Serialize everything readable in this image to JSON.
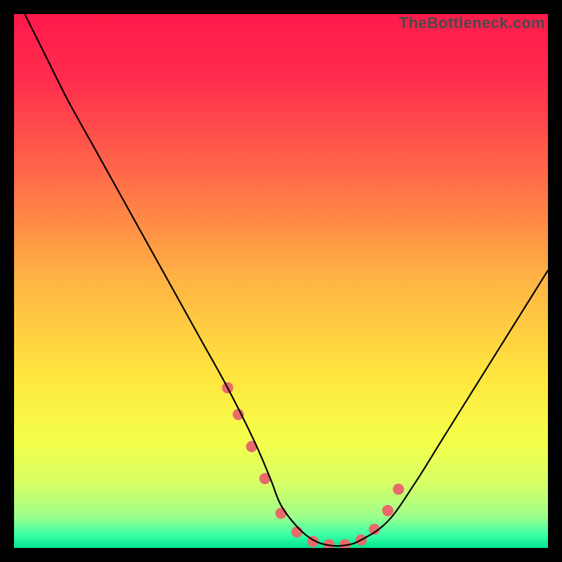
{
  "watermark": "TheBottleneck.com",
  "chart_data": {
    "type": "line",
    "title": "",
    "xlabel": "",
    "ylabel": "",
    "xlim": [
      0,
      100
    ],
    "ylim": [
      0,
      100
    ],
    "gradient_stops": [
      {
        "offset": 0.0,
        "color": "#ff1a4b"
      },
      {
        "offset": 0.12,
        "color": "#ff2b4d"
      },
      {
        "offset": 0.3,
        "color": "#ff6a49"
      },
      {
        "offset": 0.5,
        "color": "#ffb443"
      },
      {
        "offset": 0.68,
        "color": "#ffe63f"
      },
      {
        "offset": 0.8,
        "color": "#f4ff4a"
      },
      {
        "offset": 0.88,
        "color": "#d6ff66"
      },
      {
        "offset": 0.94,
        "color": "#9fff8a"
      },
      {
        "offset": 0.975,
        "color": "#3dffa8"
      },
      {
        "offset": 1.0,
        "color": "#00e58f"
      }
    ],
    "series": [
      {
        "name": "bottleneck-curve",
        "color": "#000000",
        "x": [
          2,
          6,
          10,
          15,
          20,
          25,
          30,
          35,
          40,
          45,
          48,
          50,
          53,
          56,
          59,
          62,
          65,
          70,
          75,
          80,
          85,
          90,
          95,
          100
        ],
        "y": [
          100,
          92,
          84,
          75,
          66,
          57,
          48,
          39,
          30,
          20,
          13,
          8,
          4,
          1.5,
          0.5,
          0.5,
          1.5,
          5,
          12,
          20,
          28,
          36,
          44,
          52
        ]
      }
    ],
    "markers": {
      "name": "highlight-dots",
      "color": "#e86a6a",
      "radius": 8,
      "x": [
        40,
        42,
        44.5,
        47,
        50,
        53,
        56,
        59,
        62,
        65,
        67.5,
        70,
        72
      ],
      "y": [
        30,
        25,
        19,
        13,
        6.5,
        3,
        1.2,
        0.6,
        0.6,
        1.5,
        3.5,
        7,
        11
      ]
    }
  }
}
